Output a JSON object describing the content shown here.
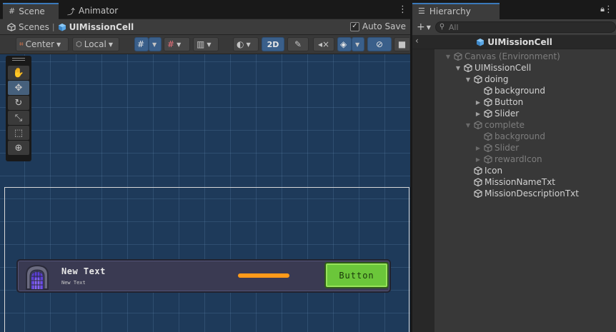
{
  "scene": {
    "tabs": [
      {
        "label": "Scene",
        "icon": "grid-icon"
      },
      {
        "label": "Animator",
        "icon": "animator-icon"
      }
    ],
    "breadcrumb": [
      {
        "label": "Scenes",
        "icon": "unity-logo-icon"
      },
      {
        "label": "UIMissionCell",
        "icon": "prefab-cube-icon"
      }
    ],
    "auto_save_label": "Auto Save",
    "auto_save_checked": true,
    "toolbar": {
      "pivot_label": "Center",
      "space_label": "Local",
      "mode_2d_label": "2D"
    },
    "cell": {
      "name_text": "New Text",
      "desc_text": "New Text",
      "button_label": "Button",
      "slider_value": 1.0
    }
  },
  "hierarchy": {
    "tab_label": "Hierarchy",
    "search_placeholder": "All",
    "header_title": "UIMissionCell",
    "rows": [
      {
        "label": "Canvas (Environment)",
        "depth": 0,
        "expanded": true,
        "has_children": true,
        "dim": true
      },
      {
        "label": "UIMissionCell",
        "depth": 1,
        "expanded": true,
        "has_children": true,
        "dim": false
      },
      {
        "label": "doing",
        "depth": 2,
        "expanded": true,
        "has_children": true,
        "dim": false
      },
      {
        "label": "background",
        "depth": 3,
        "expanded": false,
        "has_children": false,
        "dim": false
      },
      {
        "label": "Button",
        "depth": 3,
        "expanded": false,
        "has_children": true,
        "dim": false
      },
      {
        "label": "Slider",
        "depth": 3,
        "expanded": false,
        "has_children": true,
        "dim": false
      },
      {
        "label": "complete",
        "depth": 2,
        "expanded": true,
        "has_children": true,
        "dim": true
      },
      {
        "label": "background",
        "depth": 3,
        "expanded": false,
        "has_children": false,
        "dim": true
      },
      {
        "label": "Slider",
        "depth": 3,
        "expanded": false,
        "has_children": true,
        "dim": true
      },
      {
        "label": "rewardIcon",
        "depth": 3,
        "expanded": false,
        "has_children": true,
        "dim": true
      },
      {
        "label": "Icon",
        "depth": 2,
        "expanded": false,
        "has_children": false,
        "dim": false
      },
      {
        "label": "MissionNameTxt",
        "depth": 2,
        "expanded": false,
        "has_children": false,
        "dim": false
      },
      {
        "label": "MissionDescriptionTxt",
        "depth": 2,
        "expanded": false,
        "has_children": false,
        "dim": false
      }
    ]
  },
  "colors": {
    "accent_blue": "#3a79bb",
    "scene_bg": "#1e3a5a",
    "slider_orange": "#ff9a1a",
    "button_green": "#6bc63a"
  }
}
